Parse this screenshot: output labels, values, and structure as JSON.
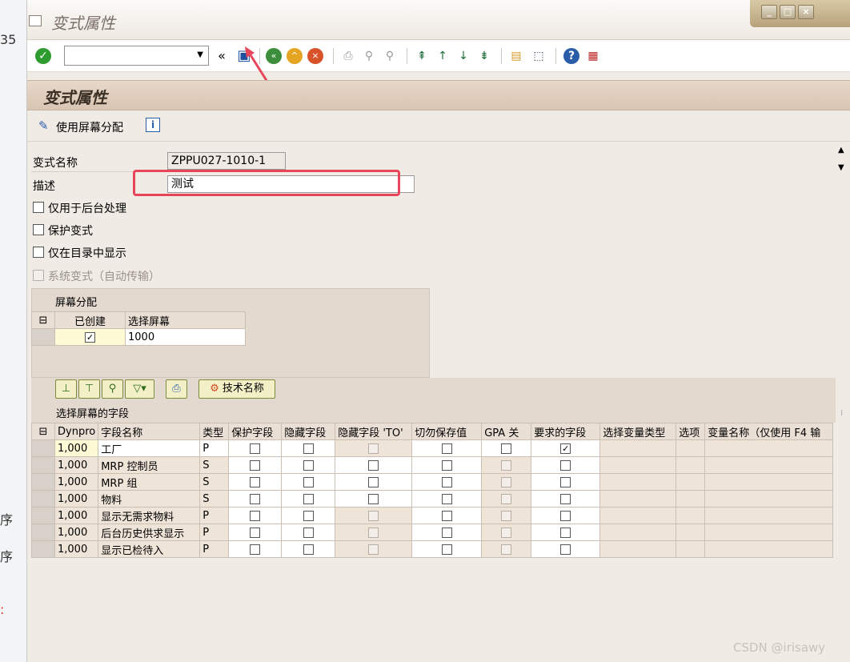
{
  "window": {
    "title": "变式属性"
  },
  "toolbar": {
    "command_value": ""
  },
  "header": {
    "title": "变式属性"
  },
  "app_toolbar": {
    "use_screen_assignment": "使用屏幕分配"
  },
  "form": {
    "variant_name_label": "变式名称",
    "variant_name_value": "ZPPU027-1010-1",
    "description_label": "描述",
    "description_value": "测试",
    "checkboxes": [
      {
        "label": "仅用于后台处理",
        "checked": false,
        "disabled": false
      },
      {
        "label": "保护变式",
        "checked": false,
        "disabled": false
      },
      {
        "label": "仅在目录中显示",
        "checked": false,
        "disabled": false
      },
      {
        "label": "系统变式（自动传输）",
        "checked": false,
        "disabled": true
      }
    ]
  },
  "screen_assignment": {
    "title": "屏幕分配",
    "col_created": "已创建",
    "col_select_screen": "选择屏幕",
    "row_screen": "1000"
  },
  "fields_toolbar": {
    "tech_name_button": "技术名称"
  },
  "fields": {
    "title": "选择屏幕的字段",
    "columns": [
      "Dynpro",
      "字段名称",
      "类型",
      "保护字段",
      "隐藏字段",
      "隐藏字段 'TO'",
      "切勿保存值",
      "GPA 关",
      "要求的字段",
      "选择变量类型",
      "选项",
      "变量名称（仅使用 F4 输"
    ],
    "rows": [
      {
        "dynpro": "1,000",
        "name": "工厂",
        "type": "P",
        "required": true
      },
      {
        "dynpro": "1,000",
        "name": "MRP 控制员",
        "type": "S",
        "required": false
      },
      {
        "dynpro": "1,000",
        "name": "MRP 组",
        "type": "S",
        "required": false
      },
      {
        "dynpro": "1,000",
        "name": "物料",
        "type": "S",
        "required": false
      },
      {
        "dynpro": "1,000",
        "name": "显示无需求物料",
        "type": "P",
        "required": false
      },
      {
        "dynpro": "1,000",
        "name": "后台历史供求显示",
        "type": "P",
        "required": false
      },
      {
        "dynpro": "1,000",
        "name": "显示已检待入",
        "type": "P",
        "required": false
      }
    ]
  },
  "watermark": "CSDN @irisawy",
  "colors": {
    "annotation_red": "#e8445a",
    "accent_green": "#2e9b2e"
  }
}
